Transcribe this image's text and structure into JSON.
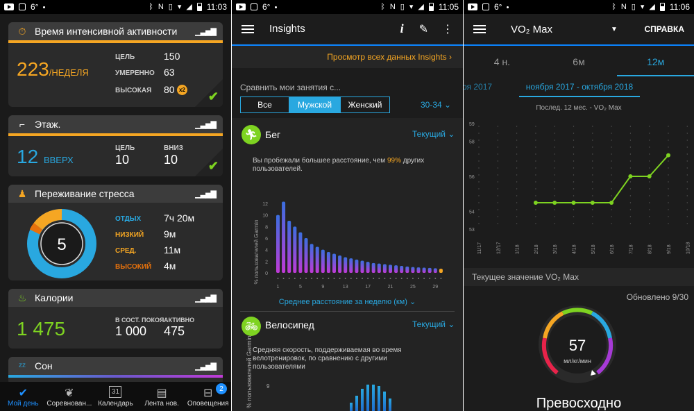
{
  "status_bars": [
    {
      "temp": "6°",
      "time": "11:03"
    },
    {
      "temp": "6°",
      "time": "11:05"
    },
    {
      "temp": "6°",
      "time": "11:06"
    }
  ],
  "my_day": {
    "intensity": {
      "title": "Время интенсивной активности",
      "value": "223",
      "unit": "/НЕДЕЛЯ",
      "goal_label": "ЦЕЛЬ",
      "goal_value": "150",
      "moderate_label": "УМЕРЕННО",
      "moderate_value": "63",
      "vigorous_label": "ВЫСОКАЯ",
      "vigorous_value": "80",
      "multiplier": "x2",
      "accent": "#f5a623"
    },
    "floors": {
      "title": "Этаж.",
      "value": "12",
      "unit": "ВВЕРХ",
      "goal_label": "ЦЕЛЬ",
      "goal_value": "10",
      "down_label": "ВНИЗ",
      "down_value": "10",
      "accent": "#f5a623"
    },
    "stress": {
      "title": "Переживание стресса",
      "center_value": "5",
      "rows": [
        {
          "label": "ОТДЫХ",
          "value": "7ч 20м",
          "color": "#29a8e0"
        },
        {
          "label": "НИЗКИЙ",
          "value": "9м",
          "color": "#f5a623"
        },
        {
          "label": "СРЕД.",
          "value": "11м",
          "color": "#f5a623"
        },
        {
          "label": "ВЫСОКИЙ",
          "value": "4м",
          "color": "#e8720c"
        }
      ]
    },
    "calories": {
      "title": "Калории",
      "total": "1 475",
      "rest_label": "В СОСТ. ПОКОЯ",
      "rest_value": "1 000",
      "active_label": "АКТИВНО",
      "active_value": "475",
      "accent": "#7ed321"
    },
    "sleep": {
      "title": "Сон"
    }
  },
  "bottom_nav": [
    {
      "label": "Мой день",
      "icon": "check-icon",
      "active": true
    },
    {
      "label": "Соревнован...",
      "icon": "laurel-icon"
    },
    {
      "label": "Календарь",
      "icon": "calendar-icon",
      "day": "31"
    },
    {
      "label": "Лента нов.",
      "icon": "newsfeed-icon"
    },
    {
      "label": "Оповещения",
      "icon": "inbox-icon",
      "badge": "2"
    }
  ],
  "insights": {
    "title": "Insights",
    "view_all": "Просмотр всех данных Insights",
    "compare_label": "Сравнить мои занятия с...",
    "segments": [
      "Все",
      "Мужской",
      "Женский"
    ],
    "selected_segment": "Мужской",
    "age": "30-34",
    "running": {
      "title": "Бег",
      "period": "Текущий",
      "text_before": "Вы пробежали большее расстояние, чем ",
      "percent": "99%",
      "text_after": " других пользователей.",
      "ylabel": "% пользователей Garmin",
      "xlabel": "Среднее расстояние за неделю (км)"
    },
    "cycling": {
      "title": "Велосипед",
      "period": "Текущий",
      "text": "Средняя скорость, поддерживаемая во время велотренировок, по сравнению с другими пользователями",
      "ylabel": "% пользователей Garmin",
      "y_top_tick": "9"
    }
  },
  "chart_data": [
    {
      "type": "bar",
      "title": "",
      "xlabel": "Среднее расстояние за неделю (км)",
      "ylabel": "% пользователей Garmin",
      "ylim": [
        0,
        12
      ],
      "yticks": [
        0,
        2,
        4,
        6,
        8,
        10,
        12
      ],
      "xticks": [
        1,
        5,
        9,
        13,
        17,
        21,
        25,
        29
      ],
      "x": [
        1,
        2,
        3,
        4,
        5,
        6,
        7,
        8,
        9,
        10,
        11,
        12,
        13,
        14,
        15,
        16,
        17,
        18,
        19,
        20,
        21,
        22,
        23,
        24,
        25,
        26,
        27,
        28,
        29,
        30
      ],
      "values": [
        10,
        12.3,
        9,
        8,
        7,
        6,
        5,
        4.5,
        4,
        3.6,
        3.3,
        3,
        2.7,
        2.5,
        2.3,
        2.1,
        1.9,
        1.7,
        1.6,
        1.5,
        1.4,
        1.3,
        1.2,
        1.1,
        1.0,
        0.95,
        0.9,
        0.85,
        0.8,
        0.7
      ],
      "highlight_index": 29
    },
    {
      "type": "line",
      "title": "VO₂ Max",
      "subtitle": "Послед. 12 мес. - VO₂ Max",
      "x": [
        "11/17",
        "12/17",
        "1/18",
        "2/18",
        "3/18",
        "4/18",
        "5/18",
        "6/18",
        "7/18",
        "8/18",
        "9/18",
        "10/18"
      ],
      "values": [
        null,
        null,
        null,
        54.5,
        54.5,
        54.5,
        54.5,
        54.5,
        56,
        56,
        57.2,
        null
      ],
      "ylim": [
        53,
        59
      ],
      "yticks": [
        53,
        54,
        56,
        58,
        59
      ],
      "color": "#7ed321"
    }
  ],
  "vo2": {
    "title": "VO₂ Max",
    "help": "СПРАВКА",
    "tabs": [
      "4 н.",
      "6м",
      "12м"
    ],
    "active_tab": "12м",
    "range_prev": "ря 2017",
    "range": "ноября 2017 - октября 2018",
    "subtitle": "Послед. 12 мес. - VO₂ Max",
    "current_label": "Текущее значение VO₂ Max",
    "updated": "Обновлено 9/30",
    "value": "57",
    "unit": "мл/кг/мин",
    "rating": "Превосходно"
  }
}
